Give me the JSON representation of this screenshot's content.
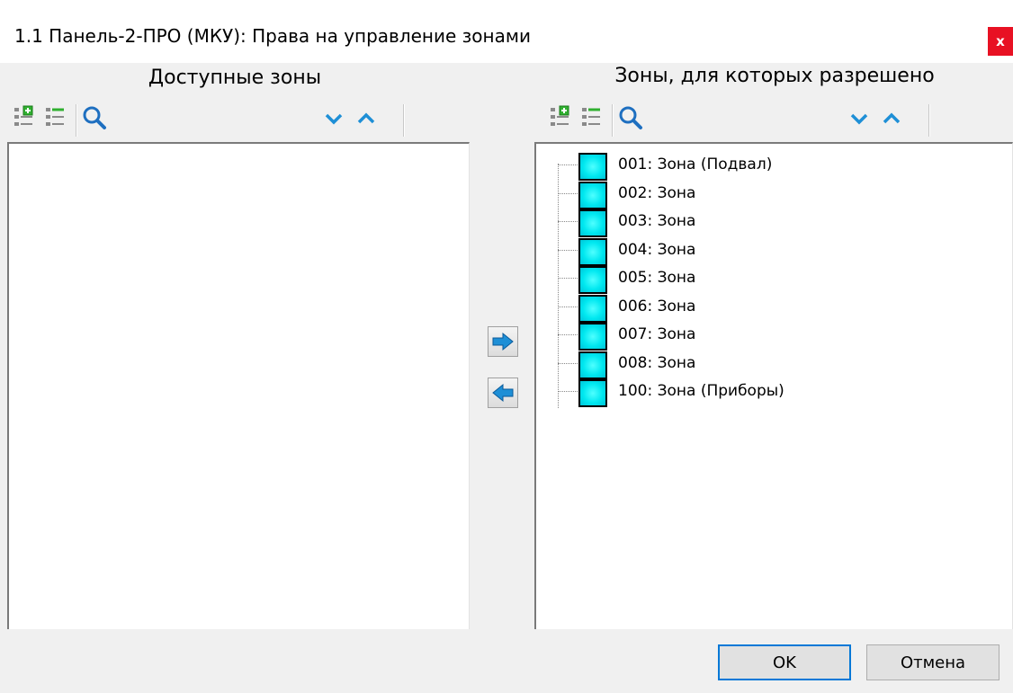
{
  "window": {
    "title": "1.1 Панель-2-ПРО (МКУ): Права на управление зонами",
    "close_label": "x"
  },
  "available_panel": {
    "title": "Доступные зоны",
    "items": []
  },
  "allowed_panel": {
    "title": "Зоны, для которых разрешено",
    "items": [
      {
        "label": "001: Зона (Подвал)"
      },
      {
        "label": "002: Зона"
      },
      {
        "label": "003: Зона"
      },
      {
        "label": "004: Зона"
      },
      {
        "label": "005: Зона"
      },
      {
        "label": "006: Зона"
      },
      {
        "label": "007: Зона"
      },
      {
        "label": "008: Зона"
      },
      {
        "label": "100: Зона (Приборы)"
      }
    ]
  },
  "toolbar_icons": [
    "expand-all-icon",
    "collapse-all-icon",
    "search-icon",
    "move-down-icon",
    "move-up-icon"
  ],
  "transfer_icons": [
    "arrow-right-icon",
    "arrow-left-icon"
  ],
  "footer": {
    "ok_label": "OK",
    "cancel_label": "Отмена"
  },
  "colors": {
    "zone_icon": "#00e8f0",
    "chevron": "#1e8fd6",
    "transfer_arrow": "#1e8fd6",
    "close_button": "#e81123"
  }
}
